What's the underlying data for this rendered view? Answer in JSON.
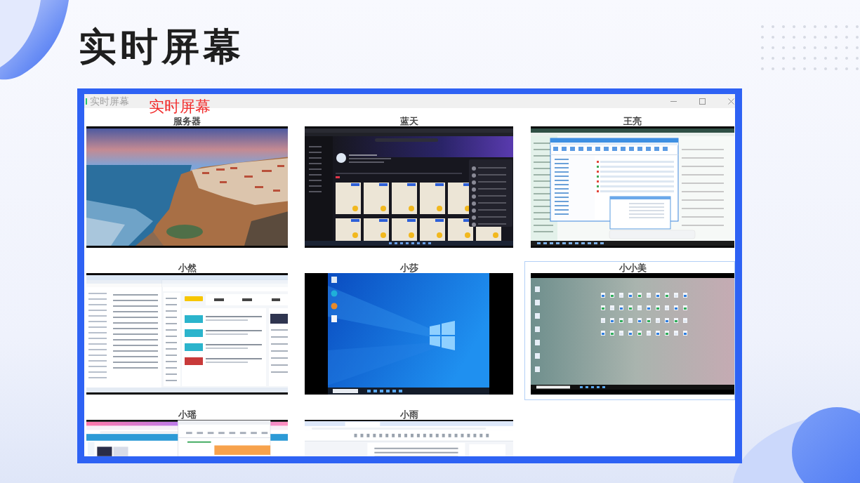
{
  "slide": {
    "title": "实时屏幕"
  },
  "window": {
    "title": "实时屏幕",
    "heading": "实时屏幕"
  },
  "screens": [
    {
      "name": "服务器",
      "kind": "lockscreen",
      "selected": false
    },
    {
      "name": "蓝天",
      "kind": "darkapp",
      "selected": false
    },
    {
      "name": "王亮",
      "kind": "fileapp",
      "selected": false
    },
    {
      "name": "小然",
      "kind": "browser",
      "selected": false
    },
    {
      "name": "小莎",
      "kind": "desktop",
      "selected": false
    },
    {
      "name": "小小美",
      "kind": "photo",
      "selected": true
    },
    {
      "name": "小瑶",
      "kind": "pinkweb",
      "selected": false
    },
    {
      "name": "小雨",
      "kind": "document",
      "selected": false
    }
  ]
}
